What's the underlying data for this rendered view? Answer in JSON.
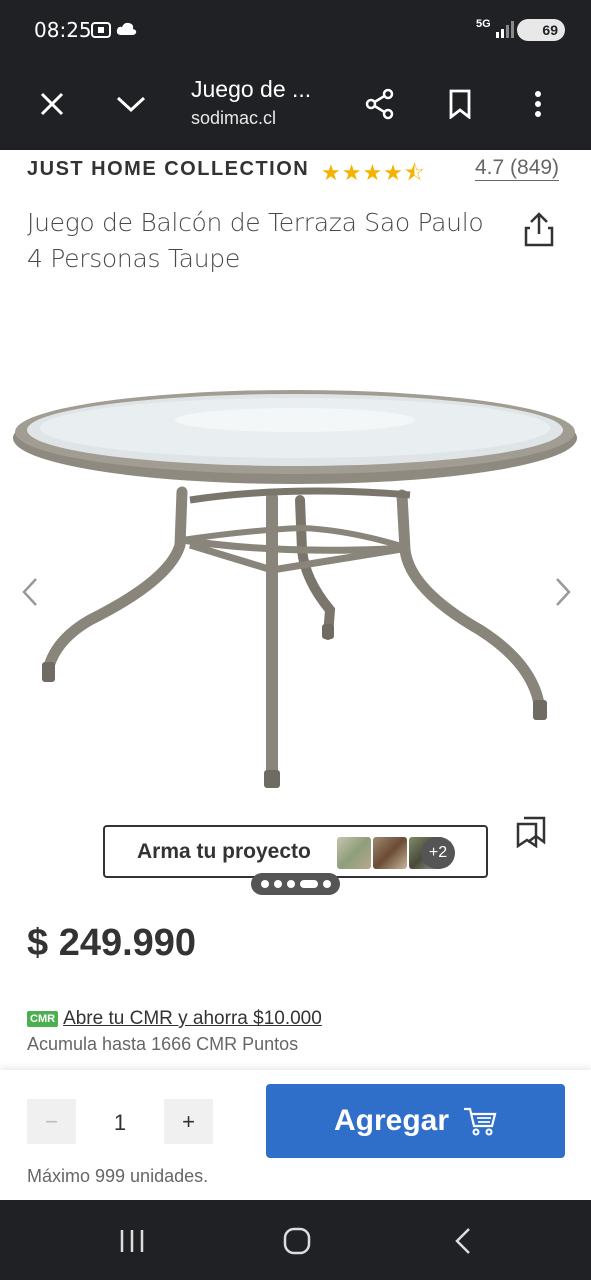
{
  "status": {
    "time": "08:25",
    "network": "5G",
    "battery": "69"
  },
  "toolbar": {
    "title": "Juego de ...",
    "url": "sodimac.cl"
  },
  "product": {
    "brand": "JUST HOME COLLECTION",
    "rating": "4.7 (849)",
    "stars": "★★★★⯪",
    "title": "Juego de Balcón de Terraza Sao Paulo 4 Personas Taupe",
    "price": "$ 249.990"
  },
  "project": {
    "label": "Arma tu proyecto",
    "more": "+2"
  },
  "cmr": {
    "badge": "CMR",
    "link": "Abre tu CMR y ahorra $10.000",
    "points": "Acumula hasta 1666 CMR Puntos"
  },
  "cart": {
    "minus": "−",
    "quantity": "1",
    "plus": "+",
    "add_label": "Agregar",
    "max_text": "Máximo 999 unidades."
  },
  "carousel": {
    "slide_count": 5,
    "active_slide": 4
  },
  "colors": {
    "accent": "#2f6fca",
    "cmr_green": "#4caf50",
    "star": "#f5b301",
    "dark_chrome": "#202124"
  }
}
